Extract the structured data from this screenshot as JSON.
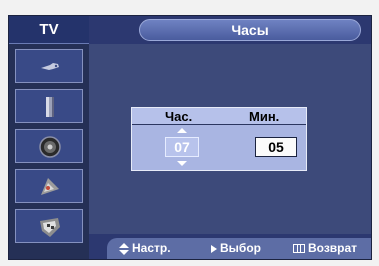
{
  "sidebar": {
    "tab_label": "TV",
    "items": [
      {
        "icon": "input-plug-icon"
      },
      {
        "icon": "picture-icon"
      },
      {
        "icon": "sound-speaker-icon"
      },
      {
        "icon": "channel-satellite-icon"
      },
      {
        "icon": "setup-icon"
      }
    ]
  },
  "header": {
    "title": "Часы"
  },
  "time_panel": {
    "hour_label": "Час.",
    "minute_label": "Мин.",
    "hour_value": "07",
    "minute_value": "05"
  },
  "help_bar": {
    "adjust_label": "Настр.",
    "select_label": "Выбор",
    "return_label": "Возврат"
  },
  "colors": {
    "background": "#3d4a7a",
    "highlight": "#a9b5e2",
    "text": "#ffffff"
  }
}
